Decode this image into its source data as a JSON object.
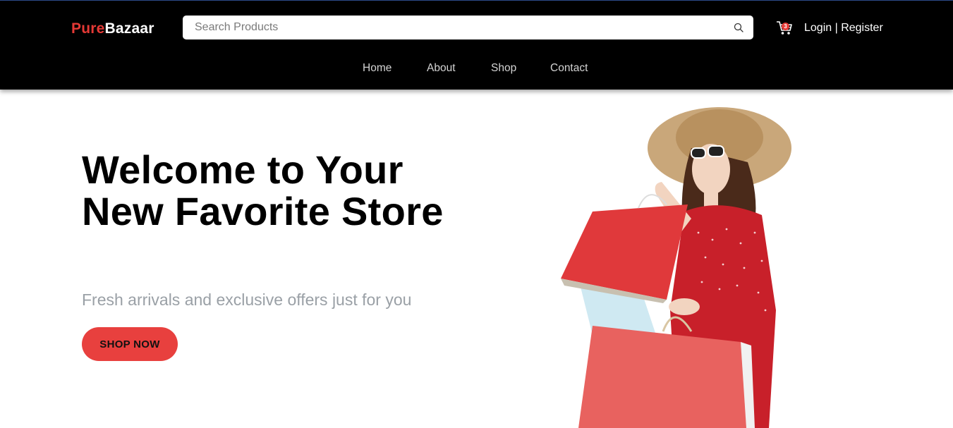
{
  "brand": {
    "part1": "Pure",
    "part2": "Bazaar"
  },
  "search": {
    "placeholder": "Search Products",
    "value": ""
  },
  "cart": {
    "count": "3"
  },
  "auth": {
    "login": "Login",
    "separator": " | ",
    "register": "Register"
  },
  "nav": {
    "home": "Home",
    "about": "About",
    "shop": "Shop",
    "contact": "Contact"
  },
  "hero": {
    "title": "Welcome to Your New Favorite Store",
    "subtitle": "Fresh arrivals and exclusive offers just for you",
    "cta": "SHOP NOW"
  },
  "colors": {
    "accent": "#e53935",
    "navbar": "#000000",
    "subtitle": "#9aa0a6"
  }
}
